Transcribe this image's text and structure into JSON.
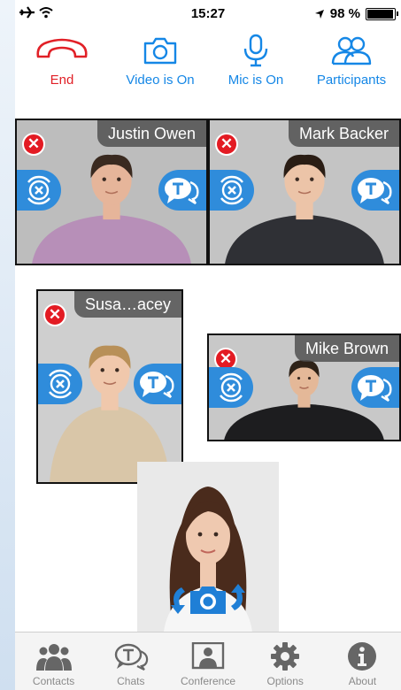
{
  "status_bar": {
    "time": "15:27",
    "battery": "98 %",
    "battery_level": 0.98
  },
  "toolbar": {
    "end_label": "End",
    "video_label": "Video is On",
    "mic_label": "Mic is On",
    "participants_label": "Participants"
  },
  "participants": [
    {
      "name": "Justin Owen",
      "skin": "#e6b59a",
      "hair": "#3a2a20",
      "shirt": "#b78fb8",
      "bg": "#bdbdbd"
    },
    {
      "name": "Mark Backer",
      "skin": "#ecc4a8",
      "hair": "#2a1d14",
      "shirt": "#2f3035",
      "bg": "#c4c4c4"
    },
    {
      "name": "Susa…acey",
      "skin": "#f0c8ac",
      "hair": "#b89058",
      "shirt": "#d9c6a8",
      "bg": "#cfcfcf"
    },
    {
      "name": "Mike Brown",
      "skin": "#e4b898",
      "hair": "#2e2218",
      "shirt": "#1d1d1f",
      "bg": "#c8c8c8"
    }
  ],
  "self_view": {
    "skin": "#efc9b0",
    "hair": "#4a2b1c",
    "shirt": "#f6f6f6"
  },
  "tabs": [
    {
      "label": "Contacts",
      "icon": "contacts-icon"
    },
    {
      "label": "Chats",
      "icon": "chats-icon"
    },
    {
      "label": "Conference",
      "icon": "conference-icon"
    },
    {
      "label": "Options",
      "icon": "gear-icon"
    },
    {
      "label": "About",
      "icon": "info-icon"
    }
  ],
  "colors": {
    "accent": "#1587e6",
    "end": "#e12027",
    "tile_button": "#2f8cdb",
    "close": "#e31b23"
  }
}
